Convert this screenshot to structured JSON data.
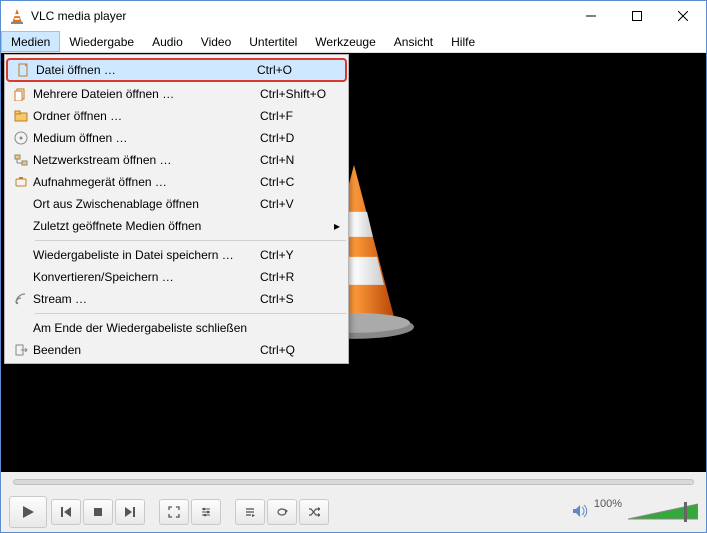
{
  "title": "VLC media player",
  "menubar": [
    "Medien",
    "Wiedergabe",
    "Audio",
    "Video",
    "Untertitel",
    "Werkzeuge",
    "Ansicht",
    "Hilfe"
  ],
  "dropdown": {
    "items": [
      {
        "icon": "file",
        "label": "Datei öffnen …",
        "shortcut": "Ctrl+O",
        "hl": true
      },
      {
        "icon": "files",
        "label": "Mehrere Dateien öffnen …",
        "shortcut": "Ctrl+Shift+O"
      },
      {
        "icon": "folder",
        "label": "Ordner öffnen …",
        "shortcut": "Ctrl+F"
      },
      {
        "icon": "disc",
        "label": "Medium öffnen …",
        "shortcut": "Ctrl+D"
      },
      {
        "icon": "network",
        "label": "Netzwerkstream öffnen …",
        "shortcut": "Ctrl+N"
      },
      {
        "icon": "capture",
        "label": "Aufnahmegerät öffnen …",
        "shortcut": "Ctrl+C"
      },
      {
        "icon": "",
        "label": "Ort aus Zwischenablage öffnen",
        "shortcut": "Ctrl+V"
      },
      {
        "icon": "",
        "label": "Zuletzt geöffnete Medien öffnen",
        "shortcut": "",
        "sub": true
      },
      {
        "sep": true
      },
      {
        "icon": "",
        "label": "Wiedergabeliste in Datei speichern …",
        "shortcut": "Ctrl+Y"
      },
      {
        "icon": "",
        "label": "Konvertieren/Speichern …",
        "shortcut": "Ctrl+R"
      },
      {
        "icon": "stream",
        "label": "Stream …",
        "shortcut": "Ctrl+S"
      },
      {
        "sep": true
      },
      {
        "icon": "",
        "label": "Am Ende der Wiedergabeliste schließen",
        "shortcut": ""
      },
      {
        "icon": "quit",
        "label": "Beenden",
        "shortcut": "Ctrl+Q"
      }
    ]
  },
  "volume_label": "100%"
}
